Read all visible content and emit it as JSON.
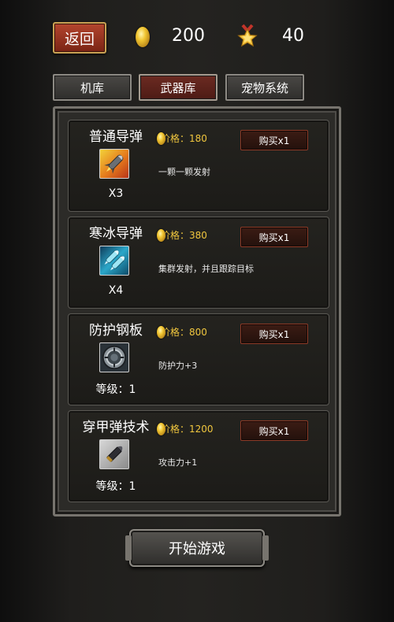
{
  "header": {
    "back_label": "返回",
    "gold": "200",
    "stars": "40"
  },
  "tabs": [
    {
      "label": "机库",
      "active": false
    },
    {
      "label": "武器库",
      "active": true
    },
    {
      "label": "宠物系统",
      "active": false
    }
  ],
  "items": [
    {
      "name": "普通导弹",
      "count": "X3",
      "price": "价格：180",
      "buy": "购买x1",
      "desc": "一颗一颗发射",
      "icon": "missile-icon"
    },
    {
      "name": "寒冰导弹",
      "count": "X4",
      "price": "价格：380",
      "buy": "购买x1",
      "desc": "集群发射，并且跟踪目标",
      "icon": "ice-missile-icon"
    },
    {
      "name": "防护钢板",
      "count": "等级：1",
      "price": "价格：800",
      "buy": "购买x1",
      "desc": "防护力+3",
      "icon": "shield-plate-icon"
    },
    {
      "name": "穿甲弹技术",
      "count": "等级：1",
      "price": "价格：1200",
      "buy": "购买x1",
      "desc": "攻击力+1",
      "icon": "armor-piercing-bullet-icon"
    }
  ],
  "start_label": "开始游戏",
  "colors": {
    "gold_text": "#f0c63e",
    "active_tab": "#6c2b22",
    "back_button": "#b4452e"
  }
}
